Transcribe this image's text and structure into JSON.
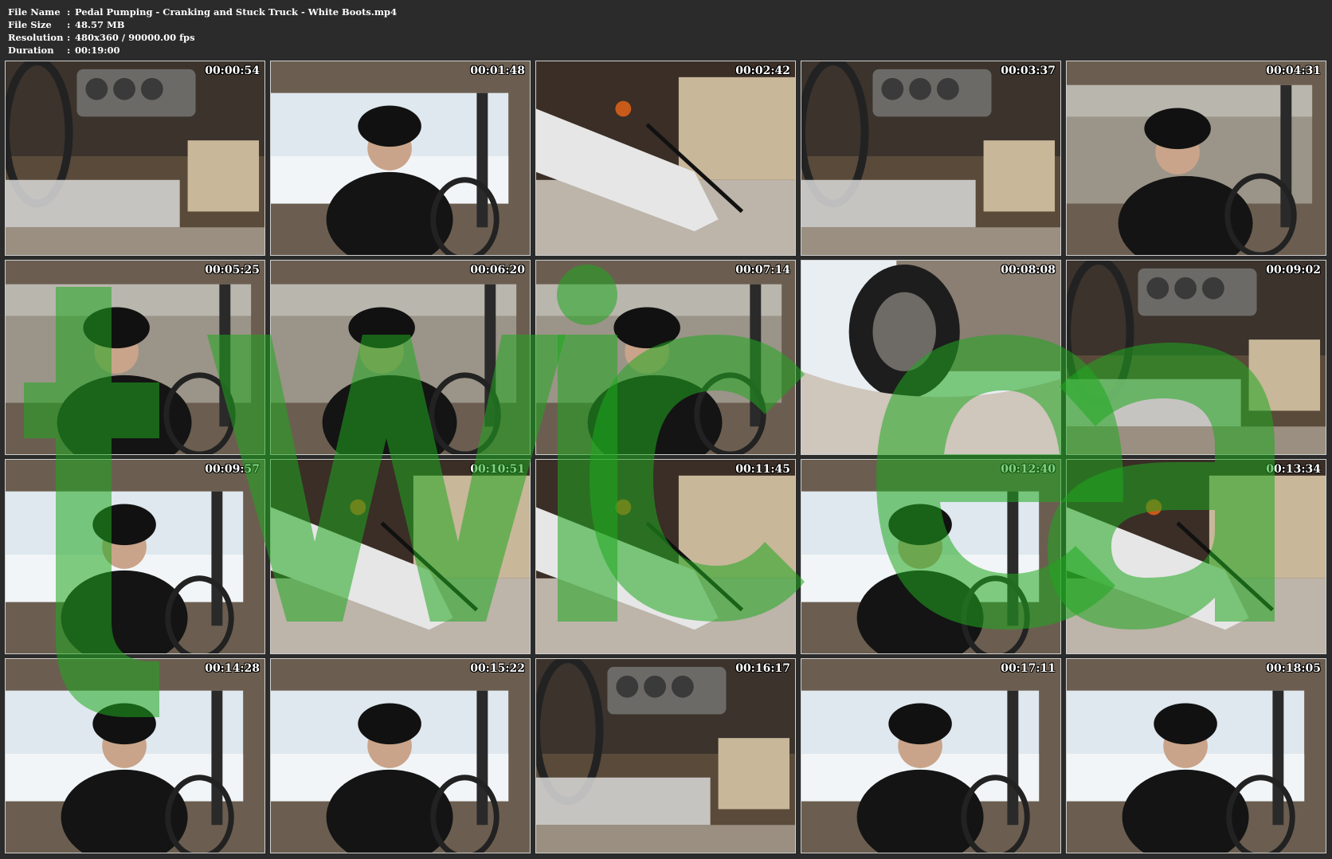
{
  "info": {
    "rows": [
      {
        "label": "File Name",
        "sep": ":",
        "value": "Pedal Pumping - Cranking and Stuck Truck - White Boots.mp4"
      },
      {
        "label": "File Size",
        "sep": ":",
        "value": "48.57 MB"
      },
      {
        "label": "Resolution",
        "sep": ":",
        "value": "480x360 / 90000.00 fps"
      },
      {
        "label": "Duration",
        "sep": ":",
        "value": "00:19:00"
      }
    ]
  },
  "thumbnails": [
    {
      "timestamp": "00:00:54",
      "scene": "dashboard-closeup"
    },
    {
      "timestamp": "00:01:48",
      "scene": "driver-window-snow"
    },
    {
      "timestamp": "00:02:42",
      "scene": "boots-pedals"
    },
    {
      "timestamp": "00:03:37",
      "scene": "dashboard-closeup"
    },
    {
      "timestamp": "00:04:31",
      "scene": "driver-window-field"
    },
    {
      "timestamp": "00:05:25",
      "scene": "driver-window-field"
    },
    {
      "timestamp": "00:06:20",
      "scene": "driver-window-field"
    },
    {
      "timestamp": "00:07:14",
      "scene": "driver-window-field"
    },
    {
      "timestamp": "00:08:08",
      "scene": "tire-snow"
    },
    {
      "timestamp": "00:09:02",
      "scene": "dashboard-closeup"
    },
    {
      "timestamp": "00:09:57",
      "scene": "driver-window-snow"
    },
    {
      "timestamp": "00:10:51",
      "scene": "boots-pedals"
    },
    {
      "timestamp": "00:11:45",
      "scene": "boots-pedals"
    },
    {
      "timestamp": "00:12:40",
      "scene": "driver-window-snow"
    },
    {
      "timestamp": "00:13:34",
      "scene": "boots-pedals"
    },
    {
      "timestamp": "00:14:28",
      "scene": "driver-window-snow"
    },
    {
      "timestamp": "00:15:22",
      "scene": "driver-window-snow"
    },
    {
      "timestamp": "00:16:17",
      "scene": "dashboard-closeup"
    },
    {
      "timestamp": "00:17:11",
      "scene": "driver-window-snow"
    },
    {
      "timestamp": "00:18:05",
      "scene": "driver-window-snow"
    }
  ],
  "colors": {
    "background": "#2b2b2b",
    "text": "#ffffff",
    "watermark": "#1fa81f"
  }
}
